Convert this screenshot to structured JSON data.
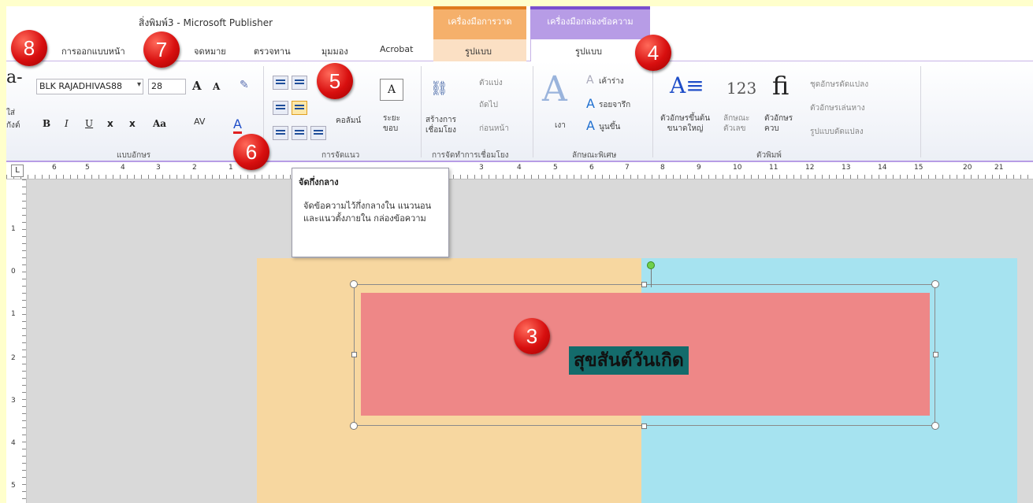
{
  "window": {
    "title": "สิ่งพิมพ์3 - Microsoft Publisher"
  },
  "contextual_tabs": {
    "drawing_tools": "เครื่องมือการวาด",
    "text_box_tools": "เครื่องมือกล่องข้อความ"
  },
  "tabs": [
    {
      "label": "การออกแบบหน้า"
    },
    {
      "label": "จดหมาย"
    },
    {
      "label": "ตรวจทาน"
    },
    {
      "label": "มุมมอง"
    },
    {
      "label": "Acrobat"
    },
    {
      "label": "รูปแบบ"
    },
    {
      "label": "รูปแบบ"
    }
  ],
  "ribbon": {
    "font": {
      "font_name": "BLK RAJADHIVAS88",
      "font_size": "28",
      "grow_font": "A",
      "shrink_font": "A",
      "bold": "B",
      "italic": "I",
      "underline": "U",
      "subscript": "x",
      "superscript": "x",
      "change_case": "Aa",
      "char_spacing": "AV",
      "font_color": "A",
      "partial_left_top": "a-",
      "partial_left_bottom": "ใส่",
      "partial_left_bottom2": "กังต์",
      "group_label": "แบบอักษร"
    },
    "alignment": {
      "columns": "คอลัมน์",
      "margins": "ระยะ\nขอบ",
      "group_label": "การจัดแนว"
    },
    "linking": {
      "create_link": "สร้างการ\nเชื่อมโยง",
      "break": "ตัวแบ่ง",
      "next": "ถัดไป",
      "previous": "ก่อนหน้า",
      "group_label": "การจัดทำการเชื่อมโยง"
    },
    "effects": {
      "shadow": "เงา",
      "outline": "เค้าร่าง",
      "engrave": "รอยจารึก",
      "emboss": "นูนขึ้น",
      "group_label": "ลักษณะพิเศษ"
    },
    "typography": {
      "drop_cap": "ตัวอักษรขึ้นต้น\nขนาดใหญ่",
      "number_style_icon": "123",
      "number_style": "ลักษณะ\nตัวเลข",
      "ligature_icon": "fi",
      "ligature": "ตัวอักษร\nควบ",
      "stylistic_sets": "ชุดอักษรดัดแปลง",
      "swash": "ตัวอักษรเล่นหาง",
      "stylistic_alternates": "รูปแบบดัดแปลง",
      "group_label": "ตัวพิมพ์"
    }
  },
  "ruler": {
    "corner": "L",
    "top_numbers": [
      "6",
      "5",
      "4",
      "3",
      "2",
      "1",
      "3",
      "4",
      "5",
      "6",
      "7",
      "8",
      "9",
      "10",
      "11",
      "12",
      "13",
      "14",
      "15",
      "20",
      "21"
    ],
    "left_numbers": [
      "1",
      "0",
      "1",
      "2",
      "3",
      "4",
      "5"
    ]
  },
  "tooltip": {
    "title": "จัดกึ่งกลาง",
    "body": "จัดข้อความไว้กึ่งกลางใน แนวนอนและแนวตั้งภายใน กล่องข้อความ"
  },
  "document": {
    "text": "สุขสันต์วันเกิด"
  },
  "markers": [
    "8",
    "7",
    "5",
    "4",
    "6",
    "3"
  ],
  "colors": {
    "left_page": "#f7d7a0",
    "right_page": "#a6e3f0",
    "text_box": "#ee8787",
    "text_highlight": "#146b6b",
    "context_draw": "#f5b06b",
    "context_text": "#b79ce6"
  }
}
